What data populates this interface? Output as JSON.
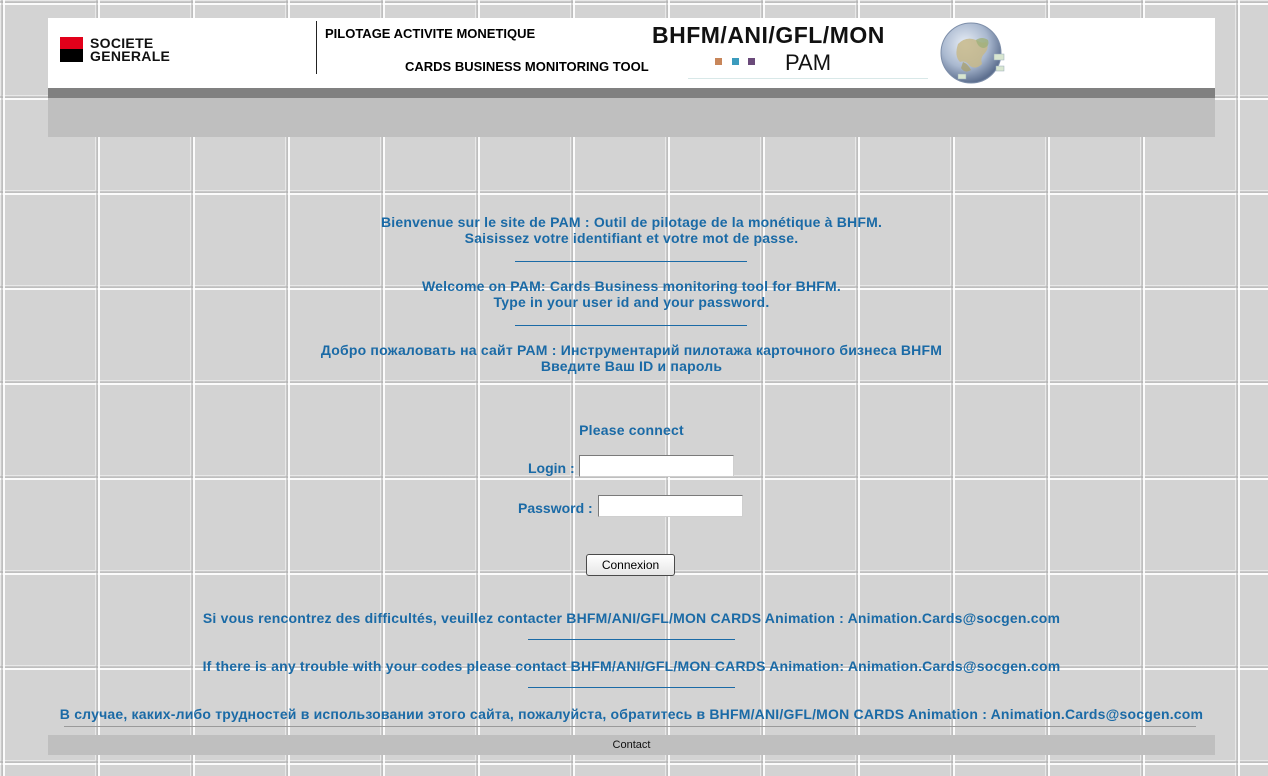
{
  "header": {
    "logo_text": "SOCIETE\nGENERALE",
    "title_fr": "PILOTAGE ACTIVITE MONETIQUE",
    "title_en": "CARDS BUSINESS MONITORING TOOL",
    "code": "BHFM/ANI/GFL/MON",
    "app_name": "PAM",
    "dot_colors": [
      "#c8865a",
      "#3b9bbd",
      "#6a4a7a"
    ],
    "brand_colors": {
      "red": "#e2001a",
      "black": "#000000"
    }
  },
  "welcome": {
    "fr_line1": "Bienvenue sur le site de PAM : Outil de pilotage de la monétique à BHFM.",
    "fr_line2": "Saisissez votre identifiant et votre mot de passe.",
    "en_line1": "Welcome on PAM: Cards Business monitoring tool for BHFM.",
    "en_line2": "Type in your user id and your password.",
    "ru_line1": "Добро пожаловать на сайт PAM : Инструментарий пилотажа карточного бизнеса BHFM",
    "ru_line2": "Введите Ваш ID и пароль"
  },
  "login": {
    "prompt": "Please connect",
    "login_label": "Login :",
    "login_value": "",
    "password_label": "Password :",
    "password_value": "",
    "submit_label": "Connexion"
  },
  "help": {
    "fr": "Si vous rencontrez des difficultés, veuillez contacter BHFM/ANI/GFL/MON CARDS Animation : Animation.Cards@socgen.com",
    "en": "If there is any trouble with your codes please contact BHFM/ANI/GFL/MON CARDS Animation: Animation.Cards@socgen.com",
    "ru": "В случае, каких-либо трудностей в использовании этого сайта, пожалуйста, обратитесь в BHFM/ANI/GFL/MON CARDS Animation : Animation.Cards@socgen.com"
  },
  "footer": {
    "contact_label": "Contact"
  },
  "theme": {
    "text_blue": "#1a6aa6",
    "bar_dark": "#808080",
    "bar_light": "#bfbfbf"
  }
}
